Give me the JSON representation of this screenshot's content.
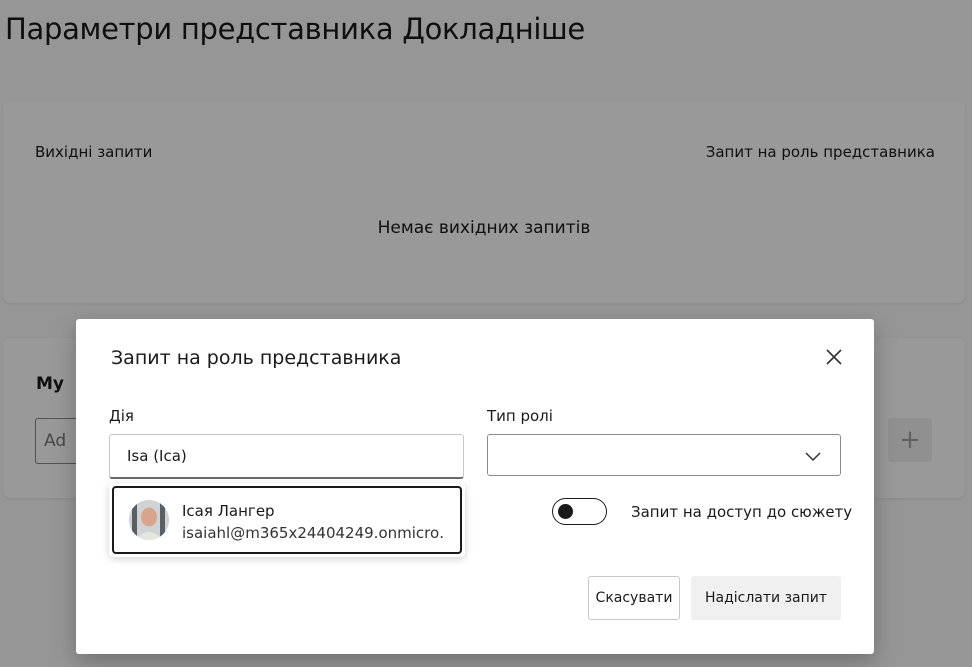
{
  "page": {
    "title": "Параметри представника Докладніше"
  },
  "requests_card": {
    "outgoing_label": "Вихідні запити",
    "request_role_link": "Запит на роль представника",
    "empty_state": "Немає вихідних запитів"
  },
  "my_card": {
    "heading": "My",
    "input_placeholder": "Ad",
    "add_button": "+"
  },
  "dialog": {
    "title": "Запит на роль представника",
    "close_icon": "close-icon",
    "action_label": "Дія",
    "action_value": "Isa (Ica)",
    "role_label": "Тип ролі",
    "role_value": "",
    "suggestion": {
      "name": "Ісая Лангер",
      "email": "isaiahl@m365x24404249.onmicro…"
    },
    "toggle_label": "Запит на доступ до сюжету",
    "toggle_on": false,
    "cancel_label": "Скасувати",
    "send_label": "Надіслати запит"
  },
  "colors": {
    "overlay": "#000000",
    "text": "#1a1a1a",
    "send_button_bg": "#f0f0f0"
  }
}
